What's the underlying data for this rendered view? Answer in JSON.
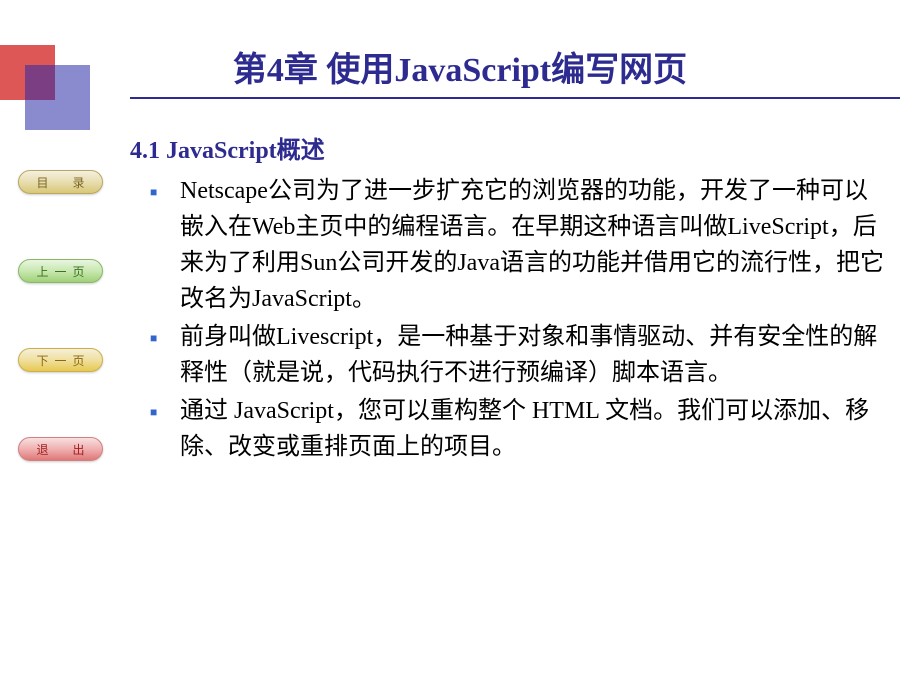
{
  "title": "第4章 使用JavaScript编写网页",
  "nav": {
    "toc": "目　录",
    "prev": "上一页",
    "next": "下一页",
    "exit": "退　出"
  },
  "section": {
    "heading": "4.1 JavaScript概述",
    "bullets": [
      " Netscape公司为了进一步扩充它的浏览器的功能，开发了一种可以嵌入在Web主页中的编程语言。在早期这种语言叫做LiveScript，后来为了利用Sun公司开发的Java语言的功能并借用它的流行性，把它改名为JavaScript。",
      "前身叫做Livescript，是一种基于对象和事情驱动、并有安全性的解释性（就是说，代码执行不进行预编译）脚本语言。",
      "通过 JavaScript，您可以重构整个 HTML 文档。我们可以添加、移除、改变或重排页面上的项目。"
    ]
  }
}
